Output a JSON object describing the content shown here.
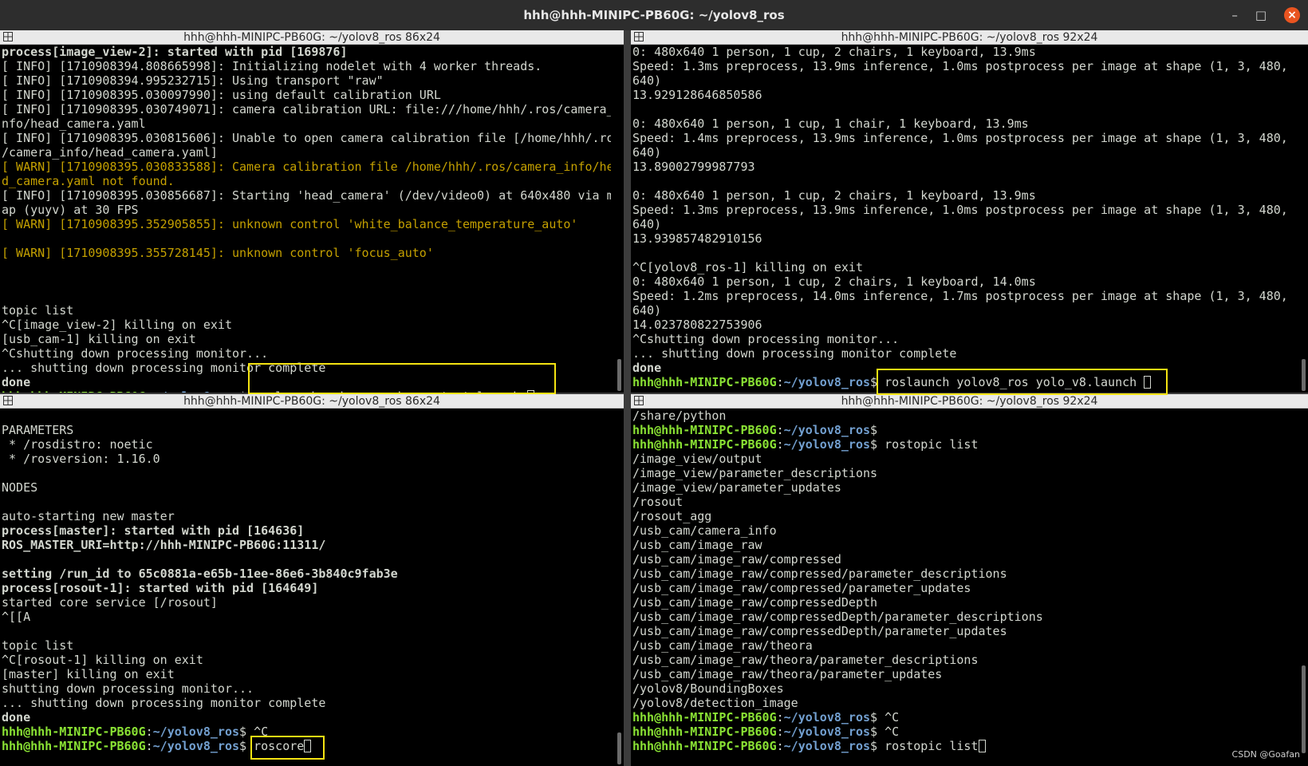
{
  "window": {
    "title": "hhh@hhh-MINIPC-PB60G: ~/yolov8_ros",
    "minimize": "–",
    "maximize": "□",
    "close": "×"
  },
  "panes": [
    {
      "title": "hhh@hhh-MINIPC-PB60G: ~/yolov8_ros 86x24",
      "lines": [
        {
          "t": "process[image_view-2]: started with pid [169876]",
          "c": "b"
        },
        {
          "t": "[ INFO] [1710908394.808665998]: Initializing nodelet with 4 worker threads.",
          "c": ""
        },
        {
          "t": "[ INFO] [1710908394.995232715]: Using transport \"raw\"",
          "c": ""
        },
        {
          "t": "[ INFO] [1710908395.030097990]: using default calibration URL",
          "c": ""
        },
        {
          "t": "[ INFO] [1710908395.030749071]: camera calibration URL: file:///home/hhh/.ros/camera_i",
          "c": ""
        },
        {
          "t": "nfo/head_camera.yaml",
          "c": ""
        },
        {
          "t": "[ INFO] [1710908395.030815606]: Unable to open camera calibration file [/home/hhh/.ros",
          "c": ""
        },
        {
          "t": "/camera_info/head_camera.yaml]",
          "c": ""
        },
        {
          "t": "[ WARN] [1710908395.030833588]: Camera calibration file /home/hhh/.ros/camera_info/hea",
          "c": "y"
        },
        {
          "t": "d_camera.yaml not found.",
          "c": "y"
        },
        {
          "t": "[ INFO] [1710908395.030856687]: Starting 'head_camera' (/dev/video0) at 640x480 via mm",
          "c": ""
        },
        {
          "t": "ap (yuyv) at 30 FPS",
          "c": ""
        },
        {
          "t": "[ WARN] [1710908395.352905855]: unknown control 'white_balance_temperature_auto'",
          "c": "y"
        },
        {
          "t": "",
          "c": ""
        },
        {
          "t": "[ WARN] [1710908395.355728145]: unknown control 'focus_auto'",
          "c": "y"
        },
        {
          "t": "",
          "c": ""
        },
        {
          "t": "",
          "c": ""
        },
        {
          "t": "",
          "c": ""
        },
        {
          "t": "topic list",
          "c": ""
        },
        {
          "t": "^C[image_view-2] killing on exit",
          "c": ""
        },
        {
          "t": "[usb_cam-1] killing on exit",
          "c": ""
        },
        {
          "t": "^Cshutting down processing monitor...",
          "c": ""
        },
        {
          "t": "... shutting down processing monitor complete",
          "c": ""
        },
        {
          "t": "done",
          "c": "b"
        }
      ],
      "prompt": {
        "user": "hhh@hhh-MINIPC-PB60G",
        "path": "~/yolov8_ros",
        "cmd": "roslaunch usb_cam usb_cam-test.launch "
      }
    },
    {
      "title": "hhh@hhh-MINIPC-PB60G: ~/yolov8_ros 92x24",
      "lines": [
        {
          "t": "0: 480x640 1 person, 1 cup, 2 chairs, 1 keyboard, 13.9ms",
          "c": ""
        },
        {
          "t": "Speed: 1.3ms preprocess, 13.9ms inference, 1.0ms postprocess per image at shape (1, 3, 480,",
          "c": ""
        },
        {
          "t": "640)",
          "c": ""
        },
        {
          "t": "13.929128646850586",
          "c": ""
        },
        {
          "t": "",
          "c": ""
        },
        {
          "t": "0: 480x640 1 person, 1 cup, 1 chair, 1 keyboard, 13.9ms",
          "c": ""
        },
        {
          "t": "Speed: 1.4ms preprocess, 13.9ms inference, 1.0ms postprocess per image at shape (1, 3, 480,",
          "c": ""
        },
        {
          "t": "640)",
          "c": ""
        },
        {
          "t": "13.89002799987793",
          "c": ""
        },
        {
          "t": "",
          "c": ""
        },
        {
          "t": "0: 480x640 1 person, 1 cup, 2 chairs, 1 keyboard, 13.9ms",
          "c": ""
        },
        {
          "t": "Speed: 1.3ms preprocess, 13.9ms inference, 1.0ms postprocess per image at shape (1, 3, 480,",
          "c": ""
        },
        {
          "t": "640)",
          "c": ""
        },
        {
          "t": "13.939857482910156",
          "c": ""
        },
        {
          "t": "",
          "c": ""
        },
        {
          "t": "^C[yolov8_ros-1] killing on exit",
          "c": ""
        },
        {
          "t": "0: 480x640 1 person, 1 cup, 2 chairs, 1 keyboard, 14.0ms",
          "c": ""
        },
        {
          "t": "Speed: 1.2ms preprocess, 14.0ms inference, 1.7ms postprocess per image at shape (1, 3, 480,",
          "c": ""
        },
        {
          "t": "640)",
          "c": ""
        },
        {
          "t": "14.023780822753906",
          "c": ""
        },
        {
          "t": "^Cshutting down processing monitor...",
          "c": ""
        },
        {
          "t": "... shutting down processing monitor complete",
          "c": ""
        },
        {
          "t": "done",
          "c": "b"
        }
      ],
      "prompt": {
        "user": "hhh@hhh-MINIPC-PB60G",
        "path": "~/yolov8_ros",
        "cmd": "roslaunch yolov8_ros yolo_v8.launch "
      }
    },
    {
      "title": "hhh@hhh-MINIPC-PB60G: ~/yolov8_ros 86x24",
      "lines": [
        {
          "t": "",
          "c": ""
        },
        {
          "t": "PARAMETERS",
          "c": ""
        },
        {
          "t": " * /rosdistro: noetic",
          "c": ""
        },
        {
          "t": " * /rosversion: 1.16.0",
          "c": ""
        },
        {
          "t": "",
          "c": ""
        },
        {
          "t": "NODES",
          "c": ""
        },
        {
          "t": "",
          "c": ""
        },
        {
          "t": "auto-starting new master",
          "c": ""
        },
        {
          "t": "process[master]: started with pid [164636]",
          "c": "b"
        },
        {
          "t": "ROS_MASTER_URI=http://hhh-MINIPC-PB60G:11311/",
          "c": "b"
        },
        {
          "t": "",
          "c": ""
        },
        {
          "t": "setting /run_id to 65c0881a-e65b-11ee-86e6-3b840c9fab3e",
          "c": "b"
        },
        {
          "t": "process[rosout-1]: started with pid [164649]",
          "c": "b"
        },
        {
          "t": "started core service [/rosout]",
          "c": ""
        },
        {
          "t": "^[[A",
          "c": ""
        },
        {
          "t": "",
          "c": ""
        },
        {
          "t": "topic list",
          "c": ""
        },
        {
          "t": "^C[rosout-1] killing on exit",
          "c": ""
        },
        {
          "t": "[master] killing on exit",
          "c": ""
        },
        {
          "t": "shutting down processing monitor...",
          "c": ""
        },
        {
          "t": "... shutting down processing monitor complete",
          "c": ""
        },
        {
          "t": "done",
          "c": "b"
        },
        {
          "t": "",
          "c": "",
          "prompt": {
            "user": "hhh@hhh-MINIPC-PB60G",
            "path": "~/yolov8_ros",
            "cmd": "^C"
          }
        }
      ],
      "prompt": {
        "user": "hhh@hhh-MINIPC-PB60G",
        "path": "~/yolov8_ros",
        "cmd": "roscore"
      }
    },
    {
      "title": "hhh@hhh-MINIPC-PB60G: ~/yolov8_ros 92x24",
      "lines": [
        {
          "t": "/share/python",
          "c": ""
        },
        {
          "t": "",
          "c": "",
          "prompt": {
            "user": "hhh@hhh-MINIPC-PB60G",
            "path": "~/yolov8_ros",
            "cmd": ""
          }
        },
        {
          "t": "",
          "c": "",
          "prompt": {
            "user": "hhh@hhh-MINIPC-PB60G",
            "path": "~/yolov8_ros",
            "cmd": "rostopic list"
          }
        },
        {
          "t": "/image_view/output",
          "c": ""
        },
        {
          "t": "/image_view/parameter_descriptions",
          "c": ""
        },
        {
          "t": "/image_view/parameter_updates",
          "c": ""
        },
        {
          "t": "/rosout",
          "c": ""
        },
        {
          "t": "/rosout_agg",
          "c": ""
        },
        {
          "t": "/usb_cam/camera_info",
          "c": ""
        },
        {
          "t": "/usb_cam/image_raw",
          "c": ""
        },
        {
          "t": "/usb_cam/image_raw/compressed",
          "c": ""
        },
        {
          "t": "/usb_cam/image_raw/compressed/parameter_descriptions",
          "c": ""
        },
        {
          "t": "/usb_cam/image_raw/compressed/parameter_updates",
          "c": ""
        },
        {
          "t": "/usb_cam/image_raw/compressedDepth",
          "c": ""
        },
        {
          "t": "/usb_cam/image_raw/compressedDepth/parameter_descriptions",
          "c": ""
        },
        {
          "t": "/usb_cam/image_raw/compressedDepth/parameter_updates",
          "c": ""
        },
        {
          "t": "/usb_cam/image_raw/theora",
          "c": ""
        },
        {
          "t": "/usb_cam/image_raw/theora/parameter_descriptions",
          "c": ""
        },
        {
          "t": "/usb_cam/image_raw/theora/parameter_updates",
          "c": ""
        },
        {
          "t": "/yolov8/BoundingBoxes",
          "c": ""
        },
        {
          "t": "/yolov8/detection_image",
          "c": ""
        },
        {
          "t": "",
          "c": "",
          "prompt": {
            "user": "hhh@hhh-MINIPC-PB60G",
            "path": "~/yolov8_ros",
            "cmd": "^C"
          }
        },
        {
          "t": "",
          "c": "",
          "prompt": {
            "user": "hhh@hhh-MINIPC-PB60G",
            "path": "~/yolov8_ros",
            "cmd": "^C"
          }
        }
      ],
      "prompt": {
        "user": "hhh@hhh-MINIPC-PB60G",
        "path": "~/yolov8_ros",
        "cmd": "rostopic list"
      }
    }
  ],
  "watermark": "CSDN @Goafan",
  "colors": {
    "prompt_user": "#8ae234",
    "prompt_path": "#729fcf",
    "warn": "#c4a000",
    "highlight": "#f4e312"
  }
}
